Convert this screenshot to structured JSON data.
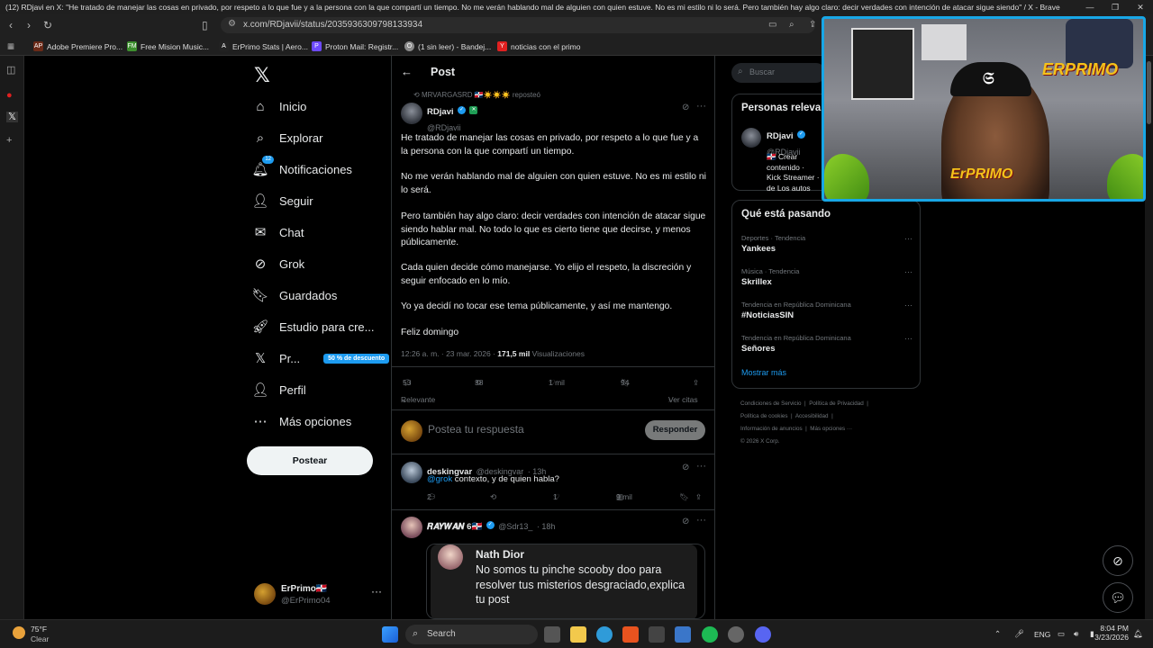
{
  "browser": {
    "window_title": "(12) RDjavi en X: \"He tratado de manejar las cosas en privado, por respeto a lo que fue y a la persona con la que compartí un tiempo. No me verán hablando mal de alguien con quien estuve. No es mi estilo ni lo será. Pero también hay algo claro: decir verdades con intención de atacar sigue siendo\" / X - Brave",
    "url": "x.com/RDjavii/status/2035936309798133934",
    "bookmarks": [
      {
        "label": "Adobe Premiere Pro...",
        "icon": "AP"
      },
      {
        "label": "Free Mision Music...",
        "icon": "FM"
      },
      {
        "label": "ErPrimo Stats | Aero...",
        "icon": "A"
      },
      {
        "label": "Proton Mail: Registr...",
        "icon": "P"
      },
      {
        "label": "(1 sin leer) - Bandej...",
        "icon": "O"
      },
      {
        "label": "noticias con el primo",
        "icon": "Y"
      }
    ]
  },
  "nav": {
    "items": [
      {
        "label": "Inicio",
        "icon": "home-icon"
      },
      {
        "label": "Explorar",
        "icon": "search-icon"
      },
      {
        "label": "Notificaciones",
        "icon": "bell-icon",
        "badge": "12"
      },
      {
        "label": "Seguir",
        "icon": "follow-icon"
      },
      {
        "label": "Chat",
        "icon": "mail-icon"
      },
      {
        "label": "Grok",
        "icon": "grok-icon"
      },
      {
        "label": "Guardados",
        "icon": "bookmark-icon"
      },
      {
        "label": "Estudio para cre...",
        "icon": "rocket-icon"
      },
      {
        "label": "Pr...",
        "icon": "x-premium-icon",
        "promo": "50 % de descuento"
      },
      {
        "label": "Perfil",
        "icon": "person-icon"
      },
      {
        "label": "Más opciones",
        "icon": "more-icon"
      }
    ],
    "post_button": "Postear",
    "account": {
      "name": "ErPrimo🇩🇴",
      "handle": "@ErPrimo04"
    }
  },
  "main": {
    "header_title": "Post",
    "repost_text": "MRVARGASRD 🇩🇴☀️☀️☀️ reposteó",
    "author": {
      "name": "RDjavi",
      "handle": "@RDjavii"
    },
    "paragraphs": [
      "He tratado de manejar las cosas en privado, por respeto a lo que fue y a la persona con la que compartí un tiempo.",
      "No me verán hablando mal de alguien con quien estuve. No es mi estilo ni lo será.",
      "Pero también hay algo claro: decir verdades con intención de atacar sigue siendo hablar mal. No todo lo que es cierto tiene que decirse, y menos públicamente.",
      "Cada quien decide cómo manejarse. Yo elijo el respeto, la discreción y seguir enfocado en lo mío.",
      "Yo ya decidí no tocar ese tema públicamente, y así me mantengo.",
      "Feliz domingo"
    ],
    "timestamp": "12:26 a. m. · 23 mar. 2026 ·",
    "views_count": "171,5 mil",
    "views_label": "Visualizaciones",
    "stats": {
      "replies": "53",
      "reposts": "38",
      "likes": "1 mil",
      "bookmarks": "94"
    },
    "sort_label": "Relevante",
    "quotes_link": "Ver citas",
    "reply_placeholder": "Postea tu respuesta",
    "reply_button": "Responder",
    "replies": [
      {
        "name": "deskingvar",
        "handle": "@deskingvar",
        "time": "· 13h",
        "mention": "@grok",
        "text": " contexto, y de quien habla?",
        "stats": {
          "replies": "2",
          "reposts": "",
          "likes": "1",
          "views": "9 mil"
        }
      },
      {
        "name": "𝑹𝑨𝒀𝑾𝑨𝑵 6🇩🇴",
        "handle": "@Sdr13_",
        "time": "· 18h",
        "quote": {
          "name": "Nath Dior",
          "text": "No somos tu pinche scooby doo para resolver tus misterios desgraciado,explica tu post"
        }
      }
    ]
  },
  "sidebar": {
    "search_placeholder": "Buscar",
    "people_title": "Personas relevantes",
    "person": {
      "name": "RDjavi",
      "handle": "@RDjavii",
      "bio": "🇩🇴 Crear contenido · Kick Streamer · de Los autos"
    },
    "trending_title": "Qué está pasando",
    "trends": [
      {
        "category": "Deportes · Tendencia",
        "title": "Yankees"
      },
      {
        "category": "Música · Tendencia",
        "title": "Skrillex"
      },
      {
        "category": "Tendencia en República Dominicana",
        "title": "#NoticiasSIN"
      },
      {
        "category": "Tendencia en República Dominicana",
        "title": "Señores"
      }
    ],
    "show_more": "Mostrar más",
    "footer_links": [
      "Condiciones de Servicio",
      "Política de Privacidad",
      "Política de cookies",
      "Accesibilidad",
      "Información de anuncios",
      "Más opciones ···",
      "© 2026 X Corp."
    ]
  },
  "webcam": {
    "overlay_text": "ERPRIMO",
    "cap_text": "ErPRIMO"
  },
  "taskbar": {
    "weather_temp": "75°F",
    "weather_desc": "Clear",
    "search_label": "Search",
    "lang": "ENG",
    "time": "8:04 PM",
    "date": "3/23/2026"
  },
  "colors": {
    "accent": "#1d9bf0",
    "background": "#000000",
    "border": "#2f3336",
    "muted": "#71767b",
    "webcam_border": "#18a7e6"
  }
}
